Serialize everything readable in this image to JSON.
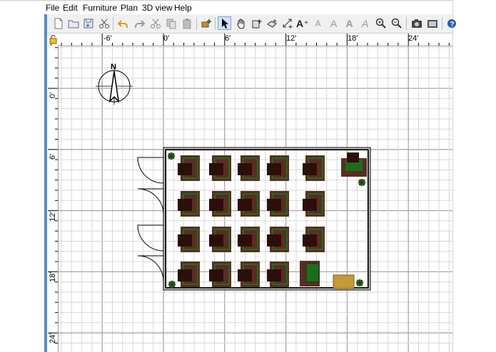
{
  "menu": {
    "file": "File",
    "edit": "Edit",
    "furniture": "Furniture",
    "plan": "Plan",
    "view3d": "3D view",
    "help": "Help"
  },
  "toolbar": {
    "icons": [
      "new-file-icon",
      "open-folder-icon",
      "save-icon",
      "cut-icon",
      "undo-icon",
      "redo-icon",
      "cut-icon",
      "copy-icon",
      "paste-icon",
      "add-furniture-icon",
      "select-icon",
      "pan-icon",
      "create-walls-icon",
      "create-rooms-icon",
      "create-dimensions-icon",
      "add-text-icon",
      "text-style-icon",
      "text-style-icon",
      "bold-text-icon",
      "italic-text-icon",
      "zoom-in-icon",
      "zoom-out-icon",
      "camera-icon",
      "photo-icon",
      "help-icon"
    ]
  },
  "ruler": {
    "horizontal": [
      "-6'",
      "0'",
      "6'",
      "12'",
      "18'",
      "24'"
    ],
    "vertical": [
      "0'",
      "6'",
      "12'",
      "18'",
      "24'"
    ]
  },
  "compass": {
    "north": "N"
  },
  "plan_colors": {
    "grid_minor": "#d7d7d7",
    "grid_major": "#a8a8a8",
    "wall": "#000000",
    "desk": "#5a2d22",
    "chair": "#2c0f0b",
    "green_seat": "#1f6b1f",
    "tan_table": "#c49a3a",
    "plant": "#3b6b2a"
  }
}
